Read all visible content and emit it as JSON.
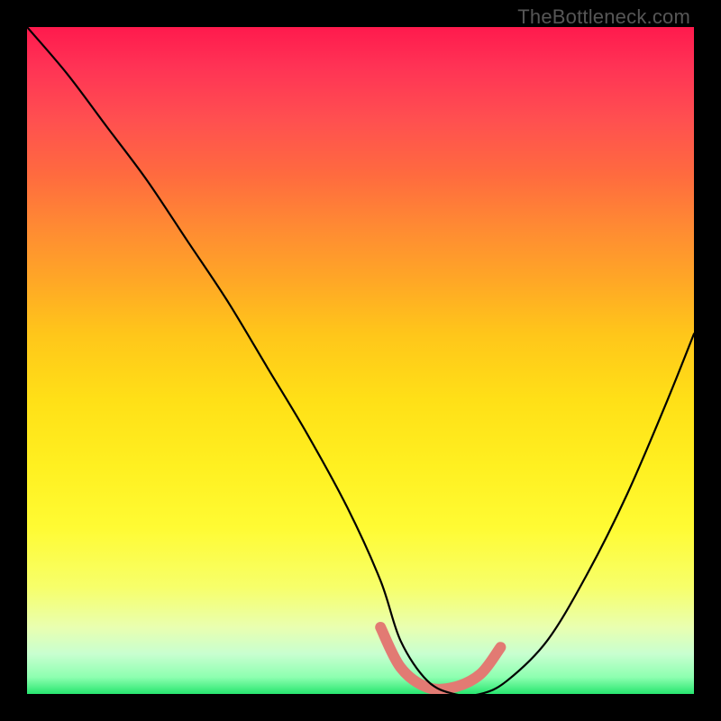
{
  "watermark": "TheBottleneck.com",
  "chart_data": {
    "type": "line",
    "title": "",
    "xlabel": "",
    "ylabel": "",
    "xlim": [
      0,
      100
    ],
    "ylim": [
      0,
      100
    ],
    "grid": false,
    "legend": false,
    "series": [
      {
        "name": "bottleneck-curve",
        "x": [
          0,
          6,
          12,
          18,
          24,
          30,
          36,
          42,
          48,
          53,
          56,
          60,
          64,
          68,
          72,
          78,
          84,
          90,
          96,
          100
        ],
        "y": [
          100,
          93,
          85,
          77,
          68,
          59,
          49,
          39,
          28,
          17,
          8,
          2,
          0,
          0,
          2,
          8,
          18,
          30,
          44,
          54
        ]
      }
    ],
    "annotations": [
      {
        "name": "valley-highlight",
        "type": "segment",
        "x": [
          53,
          56,
          60,
          64,
          68,
          71
        ],
        "y": [
          10,
          4,
          1,
          1,
          3,
          7
        ],
        "color": "#e27a73",
        "stroke_width": 12,
        "linecap": "round"
      }
    ],
    "background_gradient": {
      "direction": "vertical",
      "stops": [
        {
          "pos": 0.0,
          "color": "#ff1a4d"
        },
        {
          "pos": 0.5,
          "color": "#ffd61f"
        },
        {
          "pos": 0.85,
          "color": "#f6ff80"
        },
        {
          "pos": 1.0,
          "color": "#27e66f"
        }
      ]
    }
  }
}
